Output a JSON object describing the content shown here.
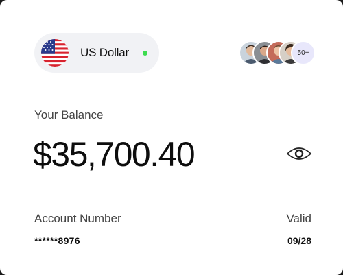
{
  "currency": {
    "name": "US Dollar",
    "flag_icon": "us-flag-icon",
    "status_color": "#3ddc4f"
  },
  "members": {
    "avatar_count_shown": 4,
    "more_label": "50+"
  },
  "balance": {
    "label": "Your Balance",
    "amount": "$35,700.40",
    "visibility_icon": "eye-icon"
  },
  "account": {
    "number_label": "Account Number",
    "number_value": "******8976",
    "valid_label": "Valid",
    "valid_value": "09/28"
  },
  "colors": {
    "background": "#ffffff",
    "pill_background": "#f1f2f5",
    "more_badge_background": "#e8e7fb",
    "text_primary": "#111111",
    "text_secondary": "#444444"
  }
}
